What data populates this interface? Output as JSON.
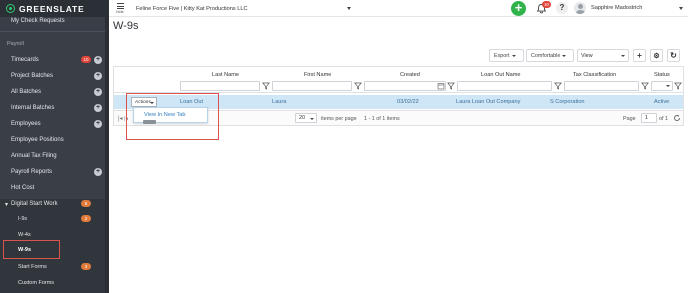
{
  "brand": {
    "name": "GREENSLATE"
  },
  "sidebar": {
    "top_item": "My Check Requests",
    "section_label": "Payroll",
    "items": [
      {
        "label": "Timecards",
        "badge": "10",
        "plus": "+"
      },
      {
        "label": "Project Batches",
        "plus": "+"
      },
      {
        "label": "All Batches",
        "plus": "+"
      },
      {
        "label": "Internal Batches",
        "plus": "+"
      },
      {
        "label": "Employees",
        "plus": "+"
      },
      {
        "label": "Employee Positions"
      },
      {
        "label": "Annual Tax Filing"
      },
      {
        "label": "Payroll Reports",
        "plus": "+"
      },
      {
        "label": "Hot Cost"
      }
    ],
    "digital_start": {
      "label": "Digital Start Work",
      "badge": "5"
    },
    "sub_items": [
      {
        "label": "I-9s",
        "badge": "2"
      },
      {
        "label": "W-4s"
      },
      {
        "label": "W-9s"
      },
      {
        "label": "Start Forms",
        "badge": "3"
      },
      {
        "label": "Custom Forms"
      }
    ]
  },
  "topbar": {
    "hide_label": "hide",
    "project": "Feline Force Five | Kitty Kat Productions LLC",
    "add_symbol": "+",
    "notification_count": "10",
    "help_symbol": "?",
    "user_name": "Sapphire Madostrich"
  },
  "page": {
    "title": "W-9s"
  },
  "toolbar": {
    "export_label": "Export",
    "density_label": "Comfortable",
    "view_label": "View",
    "add_symbol": "+",
    "settings_symbol": "⚙",
    "refresh_symbol": "↻"
  },
  "grid": {
    "columns": [
      "Last Name",
      "First Name",
      "Created",
      "Loan Out Name",
      "Tax Classification",
      "Status"
    ],
    "row": {
      "actions_label": "Actions",
      "last_name": "Loan Out",
      "first_name": "Laura",
      "created": "03/02/22",
      "loan_out_name": "Laura Loan Out Company",
      "tax_classification": "S Corporation",
      "status": "Active"
    },
    "actions_menu": [
      "View In New Tab"
    ],
    "pager": {
      "first_symbol": "|◂",
      "page_size": "20",
      "items_per_page_label": "items per page",
      "range_text": "1 - 1 of 1 items",
      "page_label": "Page",
      "page_value": "1",
      "of_text": "of 1"
    }
  },
  "colors": {
    "brand_green": "#2fb34a",
    "sidebar_bg": "#3a3f47",
    "row_selected": "#cfe6f6",
    "highlight_red": "#d9534f",
    "badge_red": "#e0453c"
  }
}
